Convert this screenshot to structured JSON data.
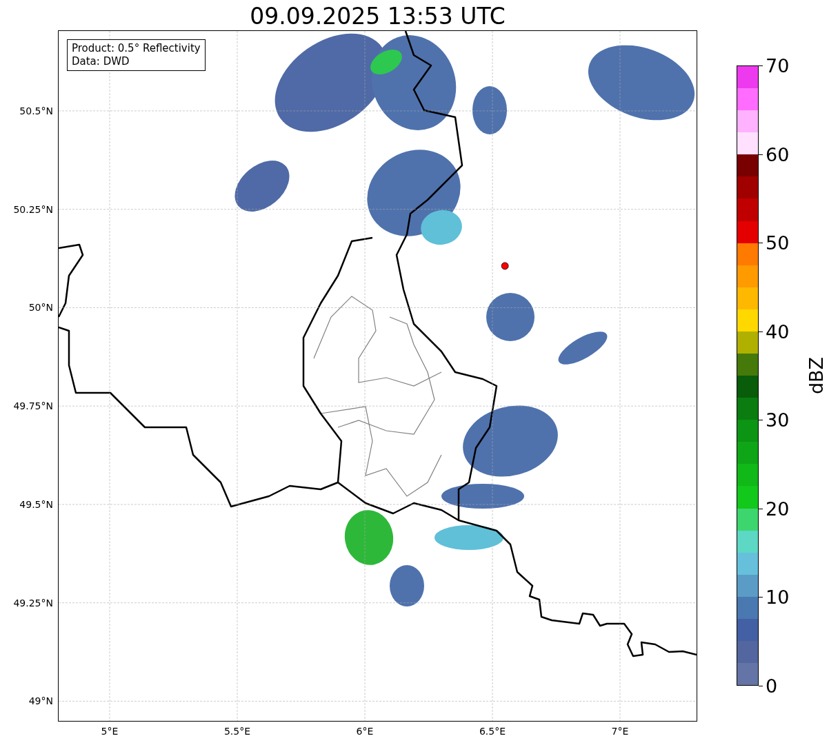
{
  "chart_data": {
    "type": "scatter",
    "title": "09.09.2025 13:53 UTC",
    "grid": true,
    "xlim": [
      4.8,
      7.3
    ],
    "ylim": [
      48.95,
      50.703
    ],
    "xticks": [
      {
        "value": 5,
        "label": "5°E"
      },
      {
        "value": 5.5,
        "label": "5.5°E"
      },
      {
        "value": 6,
        "label": "6°E"
      },
      {
        "value": 6.5,
        "label": "6.5°E"
      },
      {
        "value": 7,
        "label": "7°E"
      }
    ],
    "yticks": [
      {
        "value": 49,
        "label": "49°N"
      },
      {
        "value": 49.25,
        "label": "49.25°N"
      },
      {
        "value": 49.5,
        "label": "49.5°N"
      },
      {
        "value": 49.75,
        "label": "49.75°N"
      },
      {
        "value": 50,
        "label": "50°N"
      },
      {
        "value": 50.25,
        "label": "50.25°N"
      },
      {
        "value": 50.5,
        "label": "50.5°N"
      }
    ],
    "series": [
      {
        "color": "#ff0000",
        "x": [
          6.549
        ],
        "values": [
          50.106
        ]
      }
    ]
  },
  "info_box": [
    "Product: 0.5° Reflectivity",
    "Data: DWD"
  ],
  "colorbar": {
    "label": "dBZ",
    "ticks": [
      "70",
      "60",
      "50",
      "40",
      "30",
      "20",
      "10",
      "0"
    ],
    "segments": [
      {
        "color": "#ee3aee"
      },
      {
        "color": "#ff6cff"
      },
      {
        "color": "#ffb2ff"
      },
      {
        "color": "#ffe0ff"
      },
      {
        "color": "#780000"
      },
      {
        "color": "#a00000"
      },
      {
        "color": "#c00000"
      },
      {
        "color": "#e40000"
      },
      {
        "color": "#ff7a00"
      },
      {
        "color": "#ff9a00"
      },
      {
        "color": "#ffb800"
      },
      {
        "color": "#ffd800"
      },
      {
        "color": "#b0b000"
      },
      {
        "color": "#457a0a"
      },
      {
        "color": "#085c0a"
      },
      {
        "color": "#0a7c10"
      },
      {
        "color": "#0c9414"
      },
      {
        "color": "#0ea616"
      },
      {
        "color": "#10b818"
      },
      {
        "color": "#12c81a"
      },
      {
        "color": "#3dd66e"
      },
      {
        "color": "#5cd8c4"
      },
      {
        "color": "#66c0dc"
      },
      {
        "color": "#5a9cc6"
      },
      {
        "color": "#4a78b0"
      },
      {
        "color": "#4460a4"
      },
      {
        "color": "#5366a0"
      },
      {
        "color": "#6574a6"
      }
    ]
  }
}
